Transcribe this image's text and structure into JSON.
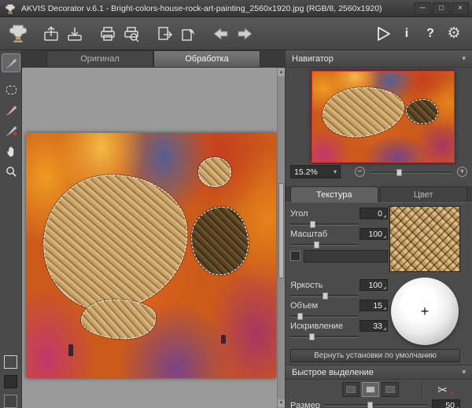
{
  "window": {
    "title": "AKVIS Decorator v.6.1 - Bright-colors-house-rock-art-painting_2560x1920.jpg (RGB/8, 2560x1920)",
    "minimize_icon": "─",
    "maximize_icon": "□",
    "close_icon": "×"
  },
  "toolbar": {
    "info_icon": "i",
    "help_icon": "?",
    "settings_icon": "⚙"
  },
  "canvas": {
    "tabs": [
      {
        "label": "Оригинал"
      },
      {
        "label": "Обработка"
      }
    ],
    "scroll_up_icon": "▲",
    "scroll_down_icon": "▼"
  },
  "navigator": {
    "title": "Навигатор",
    "collapse_icon": "▾",
    "zoom_value": "15.2%",
    "dropdown_icon": "▾",
    "zoom_out_icon": "−",
    "zoom_in_icon": "+"
  },
  "texture_panel": {
    "tabs": [
      {
        "label": "Текстура"
      },
      {
        "label": "Цвет"
      }
    ],
    "controls": [
      {
        "label": "Угол",
        "value": "0"
      },
      {
        "label": "Масштаб",
        "value": "100"
      },
      {
        "label": "Яркость",
        "value": "100"
      },
      {
        "label": "Объем",
        "value": "15"
      },
      {
        "label": "Искривление",
        "value": "33"
      }
    ],
    "texture_text_value": "",
    "sphere_plus": "+",
    "reset_button": "Вернуть установки по умолчанию"
  },
  "quick_selection": {
    "title": "Быстрое выделение",
    "collapse_icon": "▾",
    "size_label": "Размер",
    "size_value": "50",
    "scissors_icon": "✂"
  }
}
